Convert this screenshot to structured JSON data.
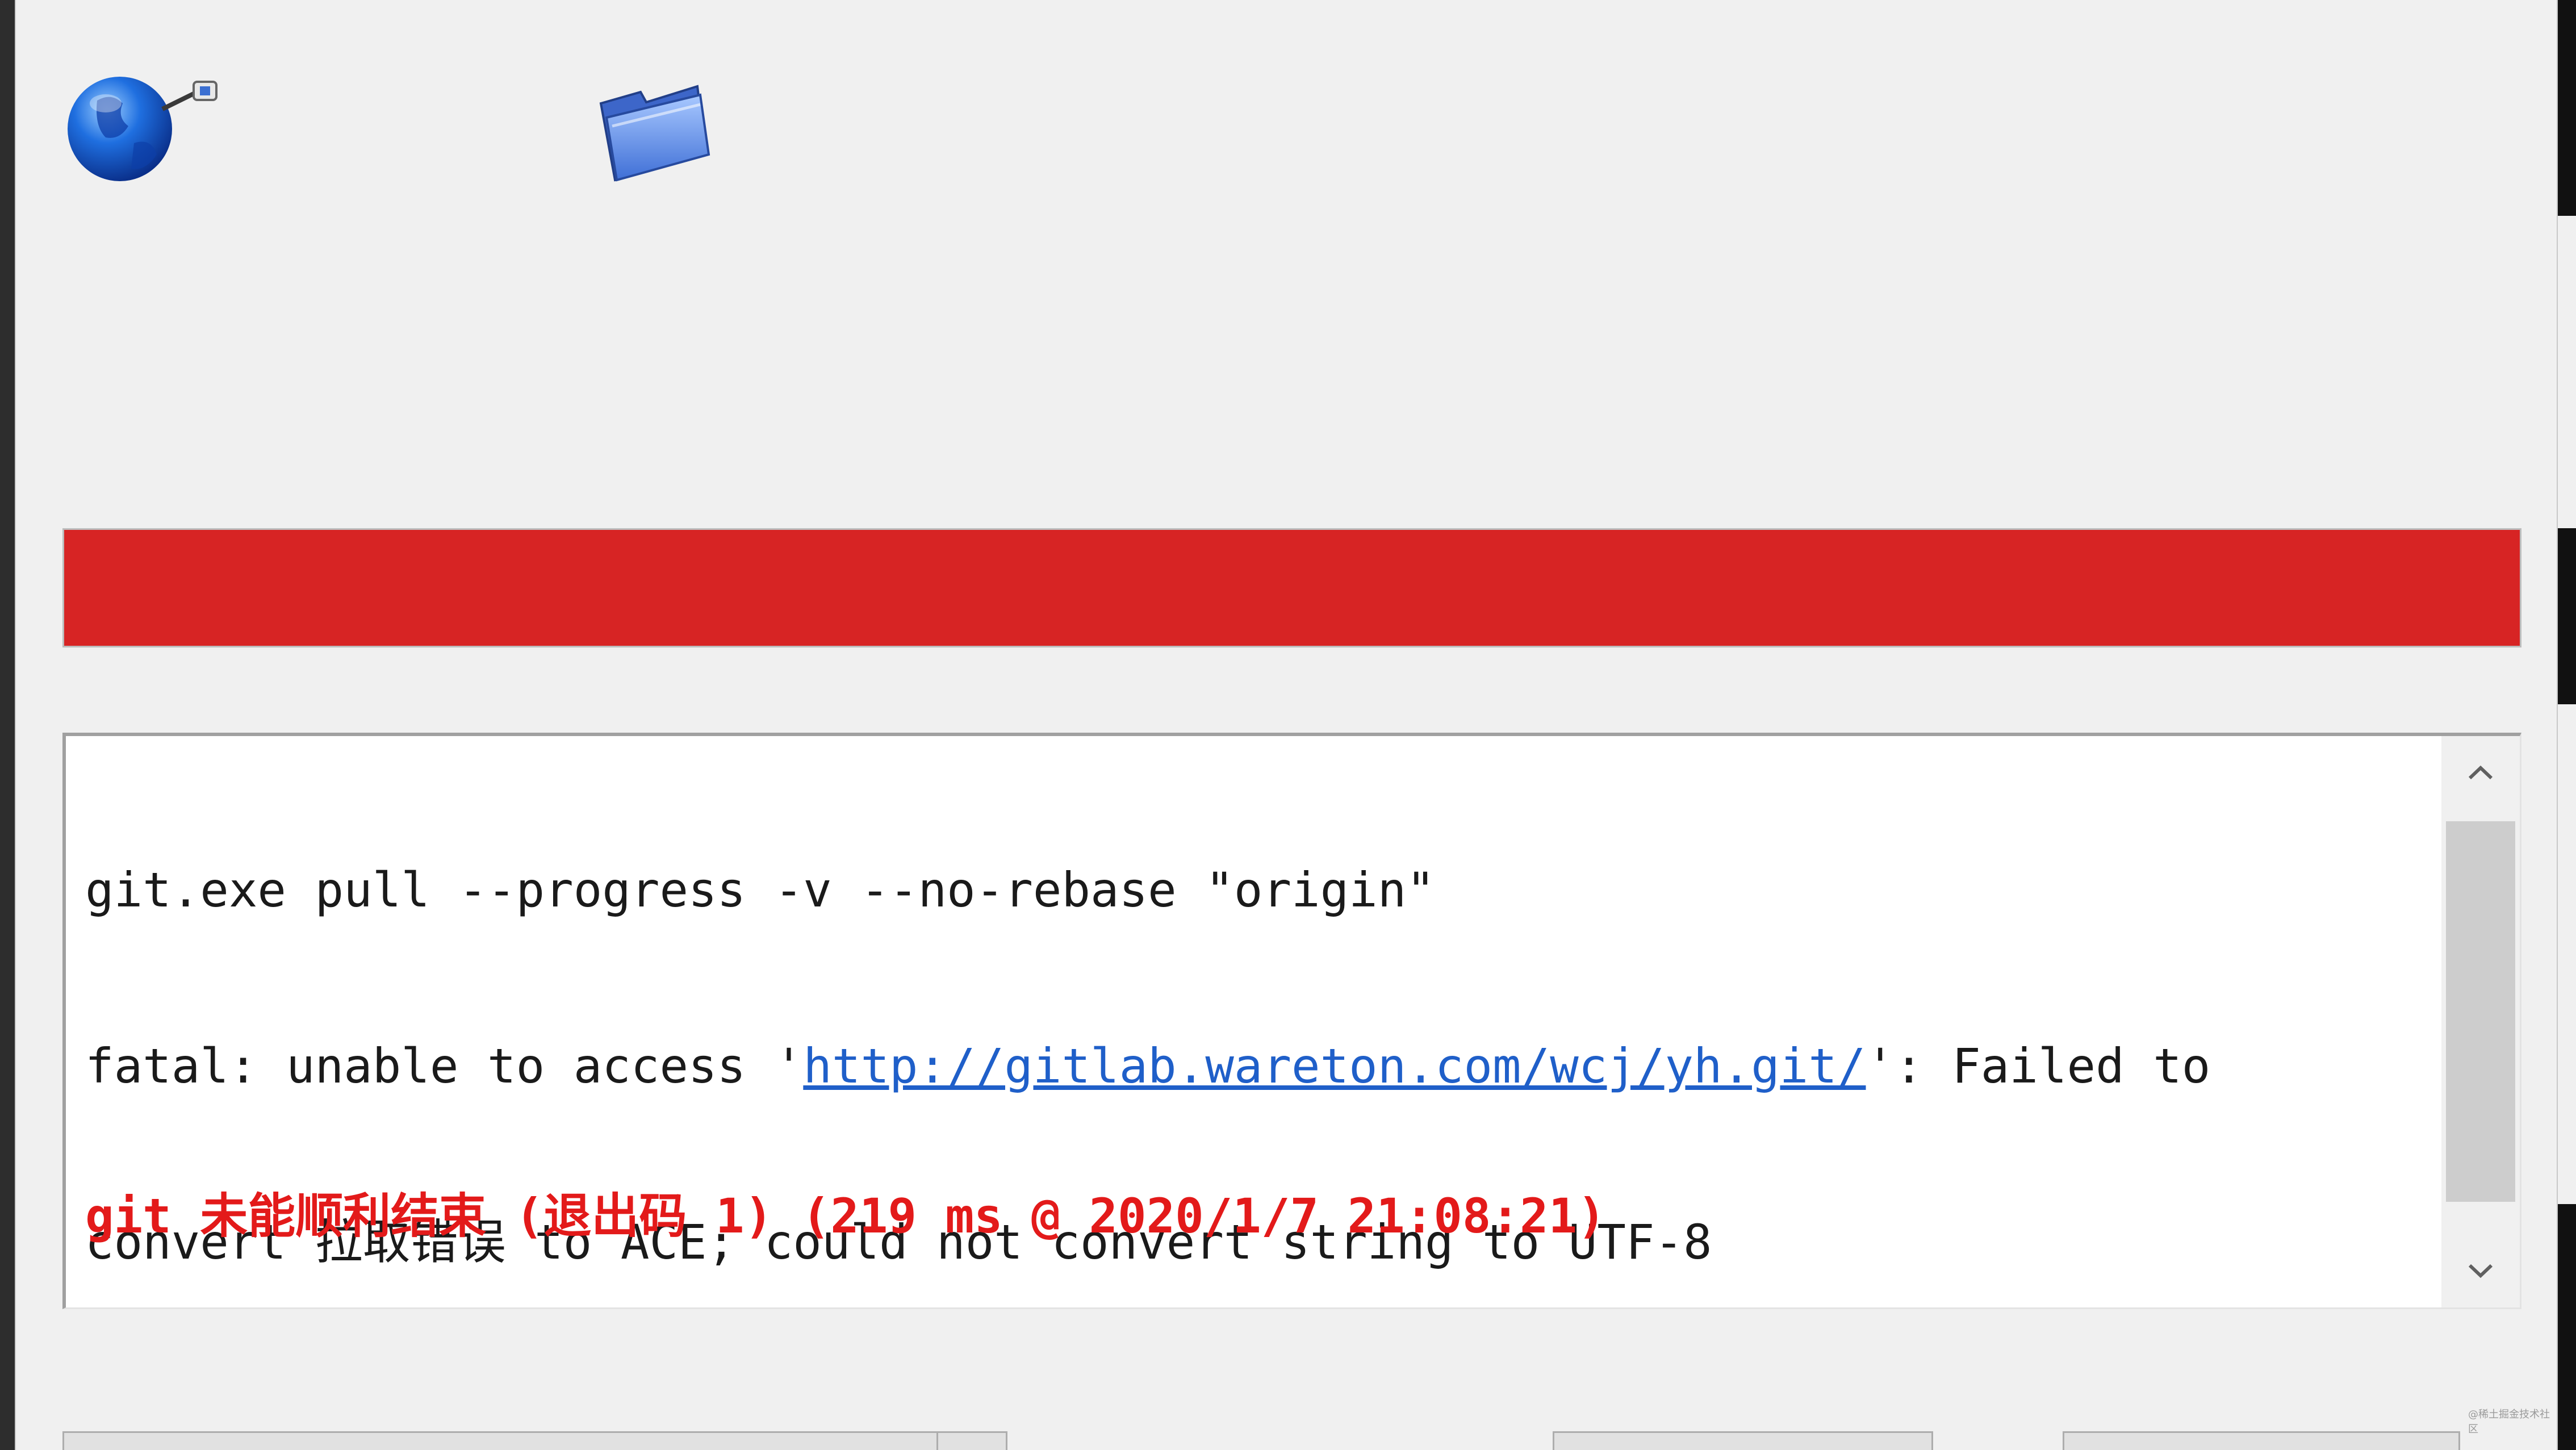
{
  "icons": {
    "remote": "globe-network-icon",
    "local": "folder-icon"
  },
  "progress": {
    "state": "error",
    "fill_fraction": 1.0,
    "color": "#d72424"
  },
  "log": {
    "command": "git.exe pull --progress -v --no-rebase \"origin\"",
    "fatal_prefix": "fatal: unable to access '",
    "url": "http://gitlab.wareton.com/wcj/yh.git/",
    "fatal_suffix": "': Failed to",
    "fatal_wrap": "convert 拉取错误 to ACE; could not convert string to UTF-8",
    "result": "git 未能顺利结束 (退出码 1) (219 ms @ 2020/1/7 21:08:21)"
  },
  "scrollbar": {
    "up_icon": "chevron-up-icon",
    "down_icon": "chevron-down-icon"
  },
  "watermark": "@稀土掘金技术社区",
  "colors": {
    "error_text": "#e31a1a",
    "link": "#1f5fc9",
    "dialog_bg": "#f0f0f0"
  }
}
